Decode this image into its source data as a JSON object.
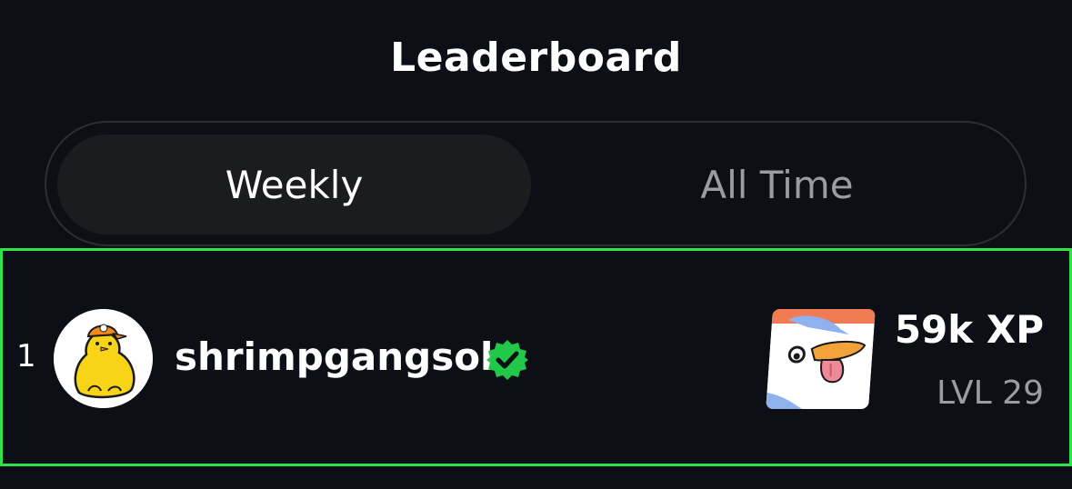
{
  "header": {
    "title": "Leaderboard"
  },
  "tabs": [
    {
      "label": "Weekly",
      "selected": true
    },
    {
      "label": "All Time",
      "selected": false
    }
  ],
  "leaderboard": {
    "rows": [
      {
        "rank": "1",
        "username": "shrimpgangsol",
        "verified": true,
        "avatar_icon": "yellow-duck-avatar-icon",
        "badge_icon": "duck-tongue-nft-icon",
        "xp": "59k XP",
        "level": "LVL 29"
      }
    ]
  },
  "colors": {
    "background": "#0c1016",
    "highlight_border": "#2ee24a",
    "verified_green": "#22c84a",
    "muted_text": "#9a9ca3",
    "tab_selected_bg": "#1b1c20"
  }
}
